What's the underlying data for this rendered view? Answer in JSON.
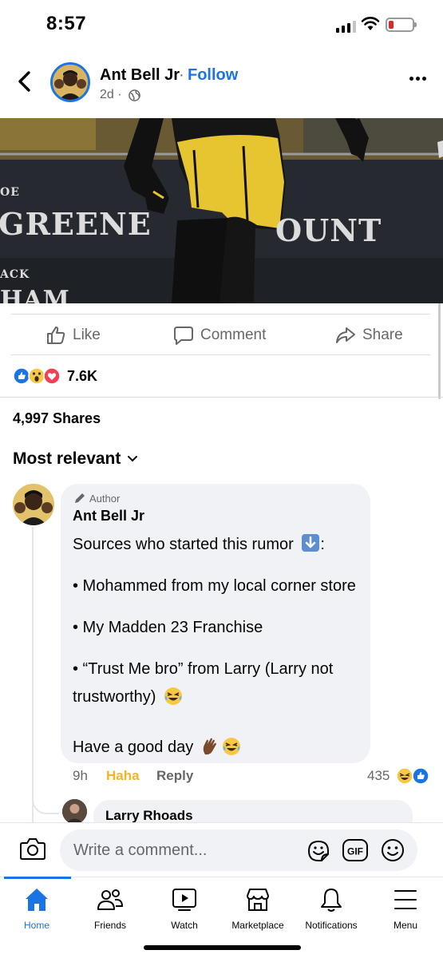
{
  "status_bar": {
    "time": "8:57"
  },
  "post_header": {
    "author": "Ant Bell Jr",
    "separator": "·",
    "follow_label": "Follow",
    "time": "2d ·"
  },
  "photo": {
    "text_1": "GREENE",
    "text_2": "OUNT",
    "text_3": "OE",
    "text_4": "ACK",
    "text_5": "HAM"
  },
  "actions": {
    "like": "Like",
    "comment": "Comment",
    "share": "Share"
  },
  "reactions": {
    "count": "7.6K",
    "types": [
      "like-icon",
      "wow-icon",
      "love-icon"
    ]
  },
  "shares": "4,997 Shares",
  "sort": {
    "label": "Most relevant"
  },
  "comment": {
    "badge": "Author",
    "name": "Ant Bell Jr",
    "lines": [
      "Sources who started this rumor",
      ":",
      "• Mohammed from my local corner store",
      "• My Madden 23 Franchise",
      "• “Trust Me bro” from Larry (Larry not",
      "trustworthy)",
      "Have a good day"
    ],
    "time": "9h",
    "haha_label": "Haha",
    "reply_label": "Reply",
    "reaction_count": "435"
  },
  "reply": {
    "name": "Larry Rhoads"
  },
  "composer": {
    "placeholder": "Write a comment..."
  },
  "tabs": [
    {
      "label": "Home"
    },
    {
      "label": "Friends"
    },
    {
      "label": "Watch"
    },
    {
      "label": "Marketplace"
    },
    {
      "label": "Notifications"
    },
    {
      "label": "Menu"
    }
  ],
  "colors": {
    "accent": "#1b74e4",
    "haha": "#f2b52a",
    "text_secondary": "#65676b",
    "love": "#f33e58"
  }
}
